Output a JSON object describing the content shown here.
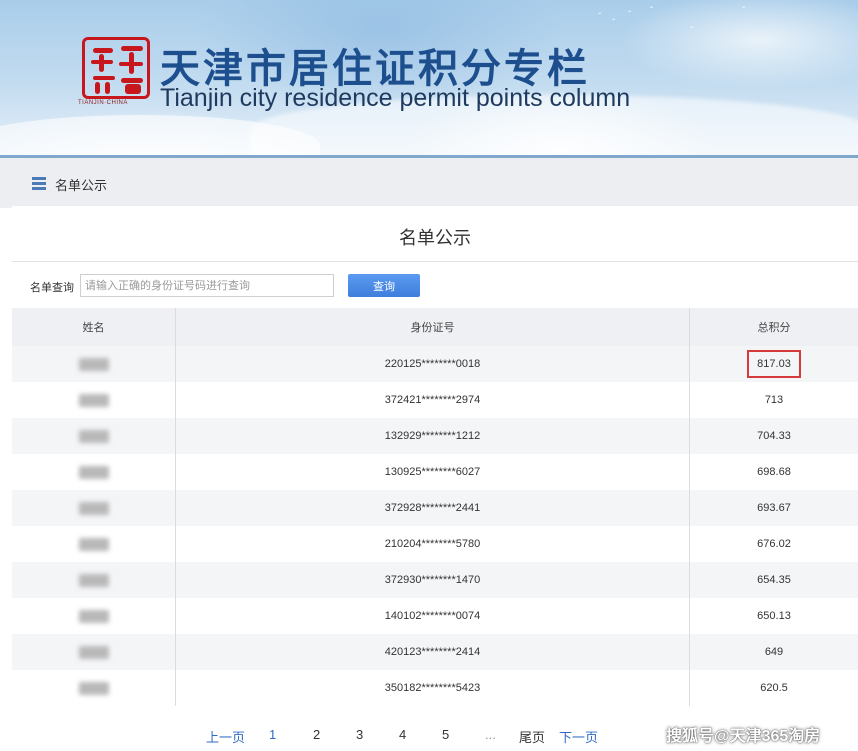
{
  "header": {
    "title_cn": "天津市居住证积分专栏",
    "title_en": "Tianjin city residence permit points column",
    "logo_seal_text": "天津欢迎您",
    "logo_caption": "TIANJIN·CHINA"
  },
  "breadcrumb": {
    "label": "名单公示"
  },
  "panel": {
    "title": "名单公示"
  },
  "search": {
    "label": "名单查询",
    "placeholder": "请输入正确的身份证号码进行查询",
    "button_label": "查询"
  },
  "table": {
    "columns": [
      "姓名",
      "身份证号",
      "总积分"
    ],
    "rows": [
      {
        "id": "220125********0018",
        "score": "817.03"
      },
      {
        "id": "372421********2974",
        "score": "713"
      },
      {
        "id": "132929********1212",
        "score": "704.33"
      },
      {
        "id": "130925********6027",
        "score": "698.68"
      },
      {
        "id": "372928********2441",
        "score": "693.67"
      },
      {
        "id": "210204********5780",
        "score": "676.02"
      },
      {
        "id": "372930********1470",
        "score": "654.35"
      },
      {
        "id": "140102********0074",
        "score": "650.13"
      },
      {
        "id": "420123********2414",
        "score": "649"
      },
      {
        "id": "350182********5423",
        "score": "620.5"
      }
    ]
  },
  "pagination": {
    "prev": "上一页",
    "pages": [
      "1",
      "2",
      "3",
      "4",
      "5"
    ],
    "ellipsis": "...",
    "last": "尾页",
    "next": "下一页",
    "current": "1"
  },
  "watermark": "搜狐号@天津365淘房",
  "colors": {
    "title_blue": "#1d4f8f",
    "link_blue": "#2f6bc4",
    "button_blue": "#3f7fdc",
    "highlight_red": "#d63b3b",
    "seal_red": "#c8161d"
  }
}
